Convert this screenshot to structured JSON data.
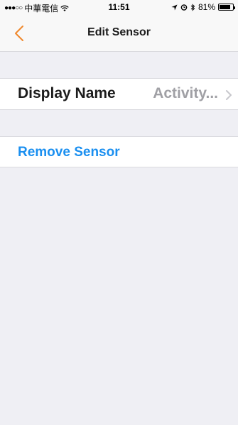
{
  "status_bar": {
    "signal": "●●●○○",
    "carrier": "中華電信",
    "time": "11:51",
    "battery_percent": "81%",
    "battery_level": 0.81
  },
  "nav": {
    "title": "Edit Sensor",
    "back_color": "#f0882b"
  },
  "settings": {
    "display_name_label": "Display Name",
    "display_name_value": "Activity...",
    "remove_label": "Remove Sensor"
  },
  "colors": {
    "accent": "#1a8ff0",
    "back_button": "#f0882b",
    "secondary_text": "#a0a0a5",
    "background": "#efeff4"
  }
}
